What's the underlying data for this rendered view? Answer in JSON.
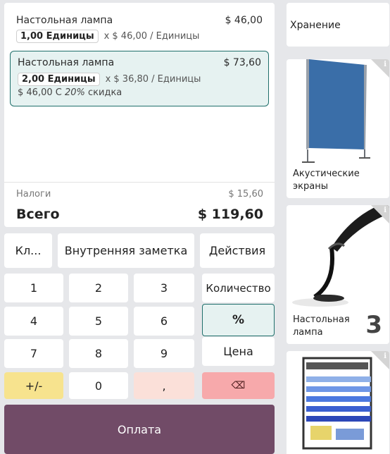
{
  "order": {
    "lines": [
      {
        "name": "Настольная лампа",
        "price": "$ 46,00",
        "qty": "1,00 Единицы",
        "unit_price": "x $ 46,00 / Единицы"
      },
      {
        "name": "Настольная лампа",
        "price": "$ 73,60",
        "qty": "2,00 Единицы",
        "unit_price": "x $ 36,80 / Единицы",
        "discount_prefix": "$ 46,00 С ",
        "discount_pct": "20%",
        "discount_suffix": " скидка"
      }
    ],
    "taxes_label": "Налоги",
    "taxes_value": "$ 15,60",
    "total_label": "Всего",
    "total_value": "$ 119,60"
  },
  "actions": {
    "customer": "Кл...",
    "note": "Внутренняя заметка",
    "more": "Действия"
  },
  "numpad": {
    "k1": "1",
    "k2": "2",
    "k3": "3",
    "k4": "4",
    "k5": "5",
    "k6": "6",
    "k7": "7",
    "k8": "8",
    "k9": "9",
    "plusminus": "+/-",
    "k0": "0",
    "comma": ",",
    "backspace": "⌫",
    "quantity": "Количество",
    "percent": "%",
    "price": "Цена"
  },
  "payment_label": "Оплата",
  "products": {
    "category": "Хранение",
    "items": [
      {
        "name": "Акустические экраны"
      },
      {
        "name": "Настольная лампа",
        "count": "3"
      },
      {
        "name": ""
      }
    ],
    "info_glyph": "i"
  },
  "colors": {
    "accent": "#714b67",
    "selected_bg": "#e6f2f1",
    "selected_border": "#1f6f6b",
    "plusminus": "#f7e38e",
    "comma": "#fbe0d9",
    "backspace": "#f7a9ab"
  }
}
